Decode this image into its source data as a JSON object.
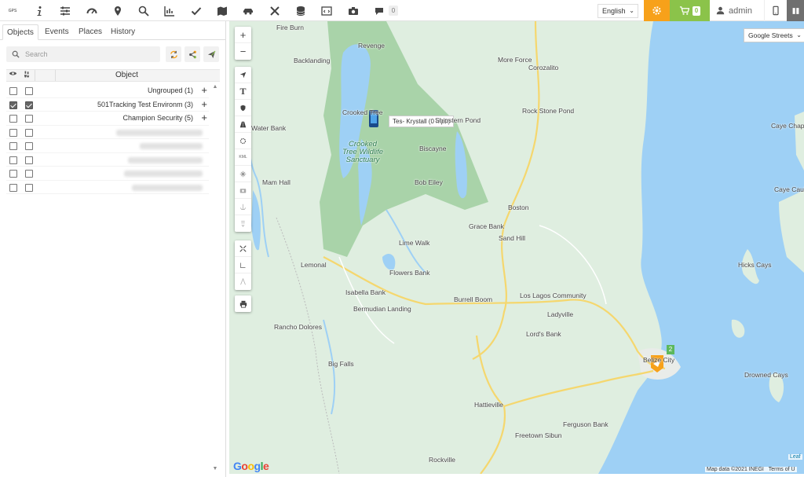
{
  "topbar": {
    "logo": "GPS",
    "message_count": "0",
    "language": "English",
    "cart_count": "0",
    "user": "admin",
    "icons": [
      "info-icon",
      "sliders-icon",
      "dashboard-icon",
      "location-pin-icon",
      "search-icon",
      "chart-icon",
      "check-icon",
      "map-book-icon",
      "car-icon",
      "tools-icon",
      "database-icon",
      "code-icon",
      "camera-icon",
      "chat-icon"
    ]
  },
  "panel": {
    "tabs": [
      "Objects",
      "Events",
      "Places",
      "History"
    ],
    "search_placeholder": "Search",
    "grid_header": {
      "object": "Object"
    },
    "rows": [
      {
        "label": "Ungrouped (1)",
        "visible": false,
        "follow": false,
        "expandable": true
      },
      {
        "label": "501Tracking Test Environm (3)",
        "visible": true,
        "follow": true,
        "expandable": true
      },
      {
        "label": "Champion Security (5)",
        "visible": false,
        "follow": false,
        "expandable": true
      },
      {
        "label": "",
        "visible": false,
        "follow": false,
        "blur": true
      },
      {
        "label": "",
        "visible": false,
        "follow": false,
        "blur": true
      },
      {
        "label": "",
        "visible": false,
        "follow": false,
        "blur": true
      },
      {
        "label": "",
        "visible": false,
        "follow": false,
        "blur": true
      },
      {
        "label": "",
        "visible": false,
        "follow": false,
        "blur": true
      }
    ]
  },
  "map": {
    "layer": "Google Streets",
    "marker_label": "Tes- Krystall (0 mph)",
    "cluster_count": "2",
    "park_label": "Crooked\nTree Wildlife\nSanctuary",
    "places": [
      "Fire Burn",
      "Revenge",
      "Backlanding",
      "More Force",
      "Corozalito",
      "Crooked Tree",
      "Rock Stone Pond",
      "Shipstern Pond",
      "Water Bank",
      "Biscayne",
      "Bob Eiley",
      "Boston",
      "Grace Bank",
      "Sand Hill",
      "Lime Walk",
      "Lemonal",
      "Flowers Bank",
      "Isabella Bank",
      "Burrell Boom",
      "Los Lagos Community",
      "Bermudian Landing",
      "Ladyville",
      "Rancho Dolores",
      "Lord's Bank",
      "Belize City",
      "Big Falls",
      "Hattieville",
      "Ferguson Bank",
      "Freetown Sibun",
      "Rockville",
      "Hicks Cays",
      "Drowned Cays",
      "Caye Chapel",
      "Caye Caulker",
      "Mam Hall"
    ],
    "attribution": "Map data ©2021 INEGI",
    "terms": "Terms of U",
    "leaflet": "Leaf",
    "google": "Google",
    "controls": {
      "zoom_in": "+",
      "zoom_out": "−"
    }
  },
  "colors": {
    "accent_orange": "#f7a11a",
    "accent_green": "#8bc34a",
    "sea": "#9ed0f5",
    "land": "#dfeee0",
    "park": "#a9d3a9"
  }
}
